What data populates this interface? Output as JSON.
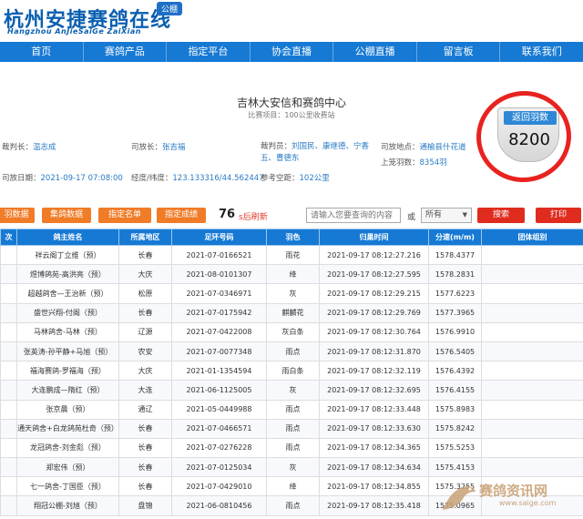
{
  "header": {
    "logo_cn": "杭州安捷赛鸽在线",
    "logo_en": "Hangzhou AnJieSaiGe ZaiXian",
    "badge": "公棚"
  },
  "nav": [
    "首页",
    "赛鸽产品",
    "指定平台",
    "协会直播",
    "公棚直播",
    "留言板",
    "联系我们"
  ],
  "race": {
    "org_name": "吉林大安信和赛鸽中心",
    "race_item": "比赛项目：100公里收费站",
    "referee_chief_label": "裁判长：",
    "referee_chief": "温志成",
    "starter_label": "司放长：",
    "starter": "张吉福",
    "referees_label": "裁判员：",
    "referees": "刘国民、康继德、宁香五、曹德东",
    "release_place_label": "司放地点：",
    "release_place": "通榆县什花道",
    "release_date_label": "司放日期：",
    "release_date": "2021-09-17 07:08:00",
    "coords_label": "经度/纬度：",
    "coords": "123.133316/44.562447",
    "ref_distance_label": "参考空距：",
    "ref_distance": "102公里",
    "loft_count_label": "上笼羽数：",
    "loft_count": "8354羽"
  },
  "return_widget": {
    "label": "返回羽数",
    "count": "8200"
  },
  "toolbar": {
    "buttons": [
      "羽数据",
      "集鸽数据",
      "指定名单",
      "指定成绩"
    ],
    "refresh_count": "76",
    "refresh_text": "s后刷新",
    "search_placeholder": "请输入您要查询的内容",
    "or_text": "或",
    "select_value": "所有",
    "search_button": "搜索",
    "print_button": "打印"
  },
  "table": {
    "columns": [
      "次",
      "鸽主姓名",
      "所属地区",
      "足环号码",
      "羽色",
      "归巢时间",
      "分速(m/m)",
      "团体组别"
    ],
    "rows": [
      [
        "",
        "祥云阁丁立维（预）",
        "长春",
        "2021-07-0166521",
        "雨花",
        "2021-09-17 08:12:27.216",
        "1578.4377",
        ""
      ],
      [
        "",
        "煜博鸽苑-高洪亮（预）",
        "大庆",
        "2021-08-0101307",
        "绛",
        "2021-09-17 08:12:27.595",
        "1578.2831",
        ""
      ],
      [
        "",
        "超越鸽舍—王治新（预）",
        "松原",
        "2021-07-0346971",
        "灰",
        "2021-09-17 08:12:29.215",
        "1577.6223",
        ""
      ],
      [
        "",
        "盛世兴翔-付阁（预）",
        "长春",
        "2021-07-0175942",
        "麒麟花",
        "2021-09-17 08:12:29.769",
        "1577.3965",
        ""
      ],
      [
        "",
        "马林鸽舍-马林（预）",
        "辽源",
        "2021-07-0422008",
        "灰白条",
        "2021-09-17 08:12:30.764",
        "1576.9910",
        ""
      ],
      [
        "",
        "张英涛-孙平静+马旭（预）",
        "农安",
        "2021-07-0077348",
        "雨点",
        "2021-09-17 08:12:31.870",
        "1576.5405",
        ""
      ],
      [
        "",
        "福海赛鸽-罗福海（预）",
        "大庆",
        "2021-01-1354594",
        "雨白条",
        "2021-09-17 08:12:32.119",
        "1576.4392",
        ""
      ],
      [
        "",
        "大连鹏成—隋红（预）",
        "大连",
        "2021-06-1125005",
        "灰",
        "2021-09-17 08:12:32.695",
        "1576.4155",
        ""
      ],
      [
        "",
        "张京晨（预）",
        "通辽",
        "2021-05-0449988",
        "雨点",
        "2021-09-17 08:12:33.448",
        "1575.8983",
        ""
      ],
      [
        "",
        "通天鸽舍+白龙鸽苑杜奇（预）",
        "长春",
        "2021-07-0466571",
        "雨点",
        "2021-09-17 08:12:33.630",
        "1575.8242",
        ""
      ],
      [
        "",
        "龙冠鸽舍-刘金彪（预）",
        "长春",
        "2021-07-0276228",
        "雨点",
        "2021-09-17 08:12:34.365",
        "1575.5253",
        ""
      ],
      [
        "",
        "郑宏伟（预）",
        "长春",
        "2021-07-0125034",
        "灰",
        "2021-09-17 08:12:34.634",
        "1575.4153",
        ""
      ],
      [
        "",
        "七一鸽舍-丁国臣（预）",
        "长春",
        "2021-07-0429010",
        "绛",
        "2021-09-17 08:12:34.855",
        "1575.3255",
        ""
      ],
      [
        "",
        "翔冠公棚-刘旭（预）",
        "盘锦",
        "2021-06-0810456",
        "雨点",
        "2021-09-17 08:12:35.418",
        "1575.0965",
        ""
      ]
    ]
  },
  "watermark": {
    "cn": "赛鸽资讯网",
    "url": "www.saige.com"
  },
  "colors": {
    "nav_blue": "#1679d4",
    "logo_blue": "#0a5fb0",
    "orange_button": "#f07c28",
    "red_button": "#e02c1f",
    "highlight_ring": "#e8231f"
  }
}
